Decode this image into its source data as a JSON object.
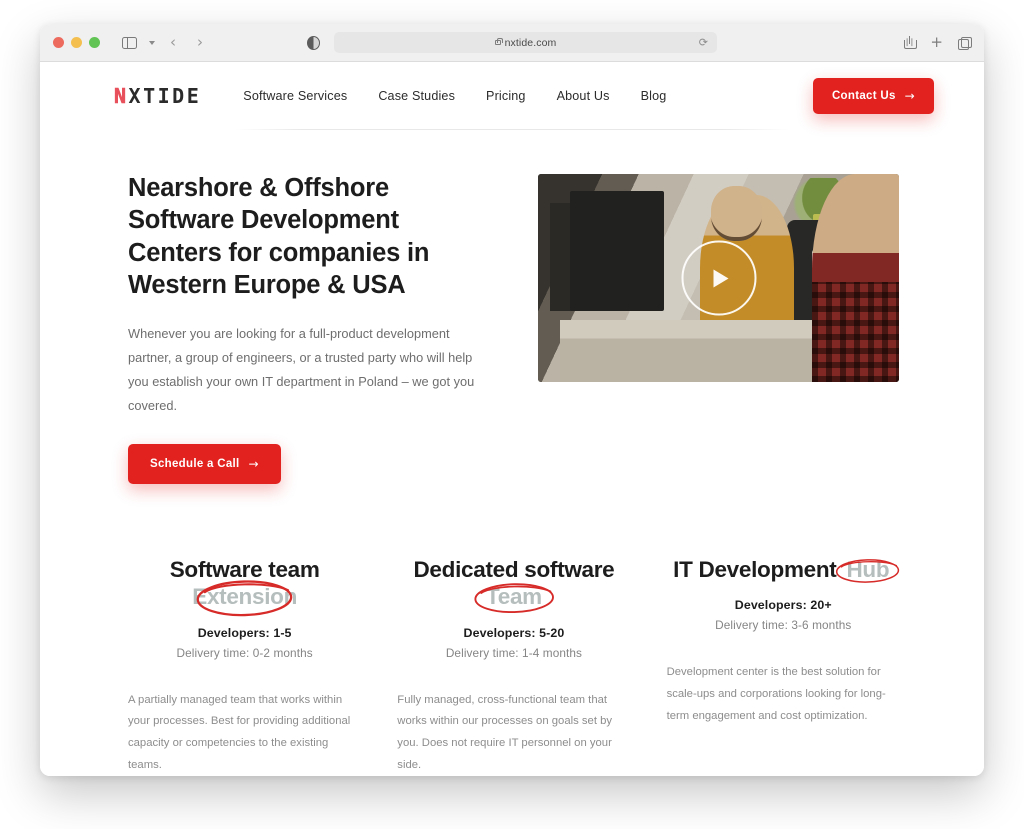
{
  "browser": {
    "url": "nxtide.com",
    "lock_icon": "lock-icon",
    "reload_icon": "⟳",
    "back_icon": "‹",
    "forward_icon": "›",
    "sidebar_icon": "sidebar-icon",
    "chevron_icon": "chevron-down-icon",
    "reader_icon": "reader-mode-icon",
    "share_icon": "share-icon",
    "newtab_icon": "+",
    "tabs_icon": "tab-overview-icon"
  },
  "site": {
    "logo": {
      "first": "N",
      "rest": "XTIDE"
    },
    "nav": [
      {
        "label": "Software Services"
      },
      {
        "label": "Case Studies"
      },
      {
        "label": "Pricing"
      },
      {
        "label": "About Us"
      },
      {
        "label": "Blog"
      }
    ],
    "contact_button": {
      "label": "Contact Us",
      "arrow": "→"
    }
  },
  "hero": {
    "title": "Nearshore & Offshore Software Development Centers for companies in Western Europe & USA",
    "subtitle": "Whenever you are looking for a full-product development partner, a group of engineers, or a trusted party who will help you establish your own IT department in Poland – we got you covered.",
    "cta": {
      "label": "Schedule a Call",
      "arrow": "→"
    },
    "video": {
      "play_icon": "play-button-icon",
      "alt": "Office developers at desk"
    }
  },
  "cards": [
    {
      "title_plain": "Software team ",
      "title_highlight": "Extension",
      "developers": "Developers: 1-5",
      "delivery": "Delivery time: 0-2 months",
      "description": "A partially managed team that works within your processes. Best for providing additional capacity or competencies to the existing teams."
    },
    {
      "title_plain": "Dedicated software ",
      "title_highlight": "Team",
      "developers": "Developers: 5-20",
      "delivery": "Delivery time: 1-4 months",
      "description": "Fully managed, cross-functional team that works within our processes on goals set by you. Does not require IT personnel on your side."
    },
    {
      "title_plain": "IT Development ",
      "title_highlight": "Hub",
      "developers": "Developers: 20+",
      "delivery": "Delivery time: 3-6 months",
      "description": "Development center is the best solution for scale-ups and corporations looking for long-term engagement and cost optimization."
    }
  ],
  "colors": {
    "accent_red": "#e1221f",
    "logo_red": "#e8505b",
    "circle_red": "#d62b28",
    "highlight_gray": "#b6bdbd",
    "text_dark": "#1d1d1d",
    "text_muted": "#8d8d8d"
  }
}
